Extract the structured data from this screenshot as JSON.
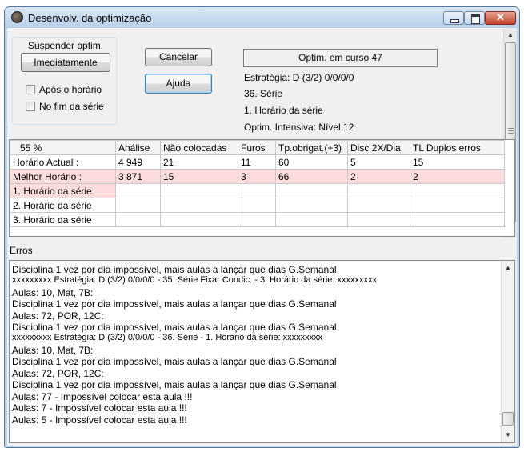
{
  "window": {
    "title": "Desenvolv. da optimização",
    "close_glyph": "✕"
  },
  "controls": {
    "group_title": "Suspender optim.",
    "immediately_label": "Imediatamente",
    "after_time_label": "Após o horário",
    "end_series_label": "No fim da série",
    "cancel_label": "Cancelar",
    "help_label": "Ajuda",
    "status_text": "Optim. em curso 47",
    "info_lines": [
      "Estratégia: D (3/2)   0/0/0/0",
      "36. Série",
      "1. Horário da série",
      "Optim. Intensiva: Nível 12"
    ]
  },
  "grid": {
    "columns": [
      "55 %",
      "Análise",
      "Não colocadas",
      "Furos",
      "Tp.obrigat.(+3)",
      "Disc 2X/Dia",
      "TL Duplos erros"
    ],
    "rows": [
      [
        "Horário Actual :",
        "4 949",
        "21",
        "11",
        "60",
        "5",
        "15"
      ],
      [
        "Melhor Horário :",
        "3 871",
        "15",
        "3",
        "66",
        "2",
        "2"
      ],
      [
        "1. Horário da série",
        "",
        "",
        "",
        "",
        "",
        ""
      ],
      [
        "2. Horário da série",
        "",
        "",
        "",
        "",
        "",
        ""
      ],
      [
        "3. Horário da série",
        "",
        "",
        "",
        "",
        "",
        ""
      ]
    ]
  },
  "errors": {
    "label": "Erros",
    "lines": [
      "   Disciplina 1 vez por dia impossível, mais aulas a lançar que dias G.Semanal",
      "xxxxxxxxx        Estratégia: D (3/2)   0/0/0/0 - 35. Série  Fixar Condic. - 3. Horário da série:         xxxxxxxxx",
      "Aulas: 10, Mat, 7B:",
      "   Disciplina 1 vez por dia impossível, mais aulas a lançar que dias G.Semanal",
      "Aulas: 72, POR, 12C:",
      "   Disciplina 1 vez por dia impossível, mais aulas a lançar que dias G.Semanal",
      "xxxxxxxxx        Estratégia: D (3/2)   0/0/0/0 - 36. Série - 1. Horário da série:        xxxxxxxxx",
      "Aulas: 10, Mat, 7B:",
      "   Disciplina 1 vez por dia impossível, mais aulas a lançar que dias G.Semanal",
      "Aulas: 72, POR, 12C:",
      "   Disciplina 1 vez por dia impossível, mais aulas a lançar que dias G.Semanal",
      "Aulas: 77  -  Impossível colocar esta aula !!!",
      "Aulas: 7  -  Impossível colocar esta aula !!!",
      "Aulas: 5  -  Impossível colocar esta aula !!!"
    ]
  },
  "scroll": {
    "up_glyph": "▲",
    "down_glyph": "▼"
  }
}
